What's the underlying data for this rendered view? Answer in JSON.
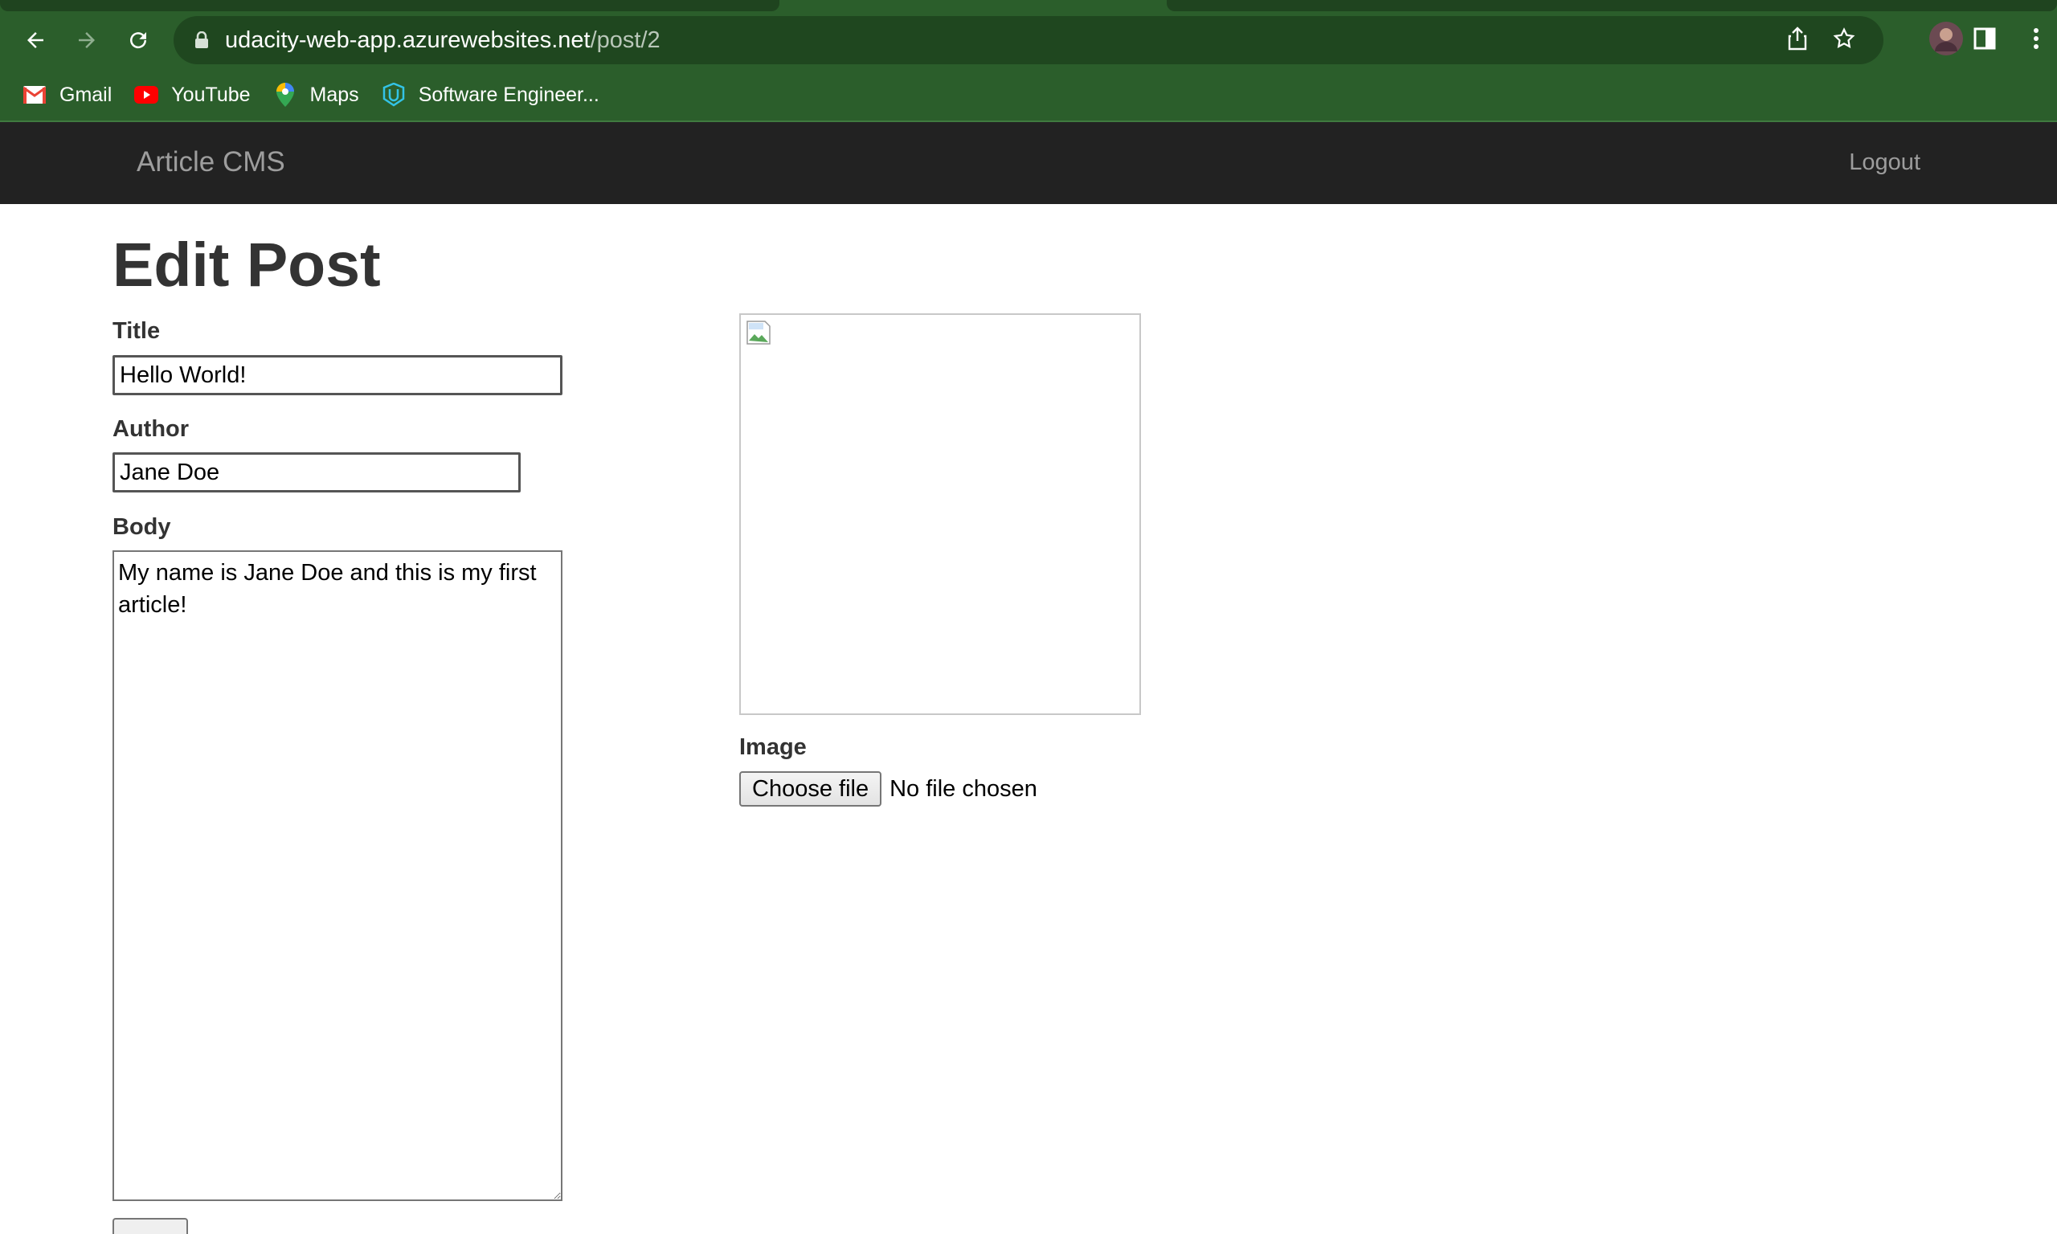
{
  "browser": {
    "url_host": "udacity-web-app.azurewebsites.net",
    "url_path": "/post/2",
    "bookmarks": [
      {
        "label": "Gmail",
        "icon": "gmail-icon"
      },
      {
        "label": "YouTube",
        "icon": "youtube-icon"
      },
      {
        "label": "Maps",
        "icon": "maps-icon"
      },
      {
        "label": "Software Engineer...",
        "icon": "udacity-icon"
      }
    ]
  },
  "navbar": {
    "brand": "Article CMS",
    "logout_label": "Logout"
  },
  "form": {
    "heading": "Edit Post",
    "title_label": "Title",
    "title_value": "Hello World!",
    "author_label": "Author",
    "author_value": "Jane Doe",
    "body_label": "Body",
    "body_value": "My name is Jane Doe and this is my first article!",
    "image_label": "Image",
    "choose_file_label": "Choose file",
    "no_file_text": "No file chosen"
  },
  "colors": {
    "chrome": "#2b5e2b",
    "omnibox": "#1f471f",
    "navbar": "#222222",
    "navbar_text": "#9d9d9d"
  }
}
